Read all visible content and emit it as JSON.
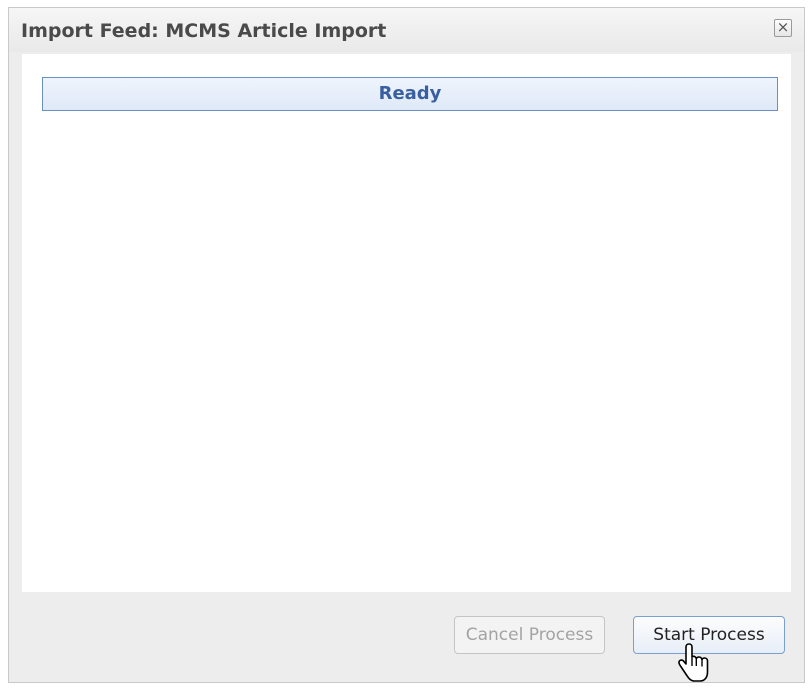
{
  "dialog": {
    "title": "Import Feed: MCMS Article Import",
    "close_icon": "close-icon",
    "close_glyph": "×"
  },
  "status": {
    "text": "Ready"
  },
  "footer": {
    "cancel_label": "Cancel Process",
    "cancel_enabled": false,
    "start_label": "Start Process",
    "start_enabled": true
  },
  "cursor": {
    "icon": "hand-pointer-icon"
  },
  "colors": {
    "accent": "#3a5f9f",
    "status_border": "#6c8fc1",
    "dialog_background": "#ededed"
  }
}
